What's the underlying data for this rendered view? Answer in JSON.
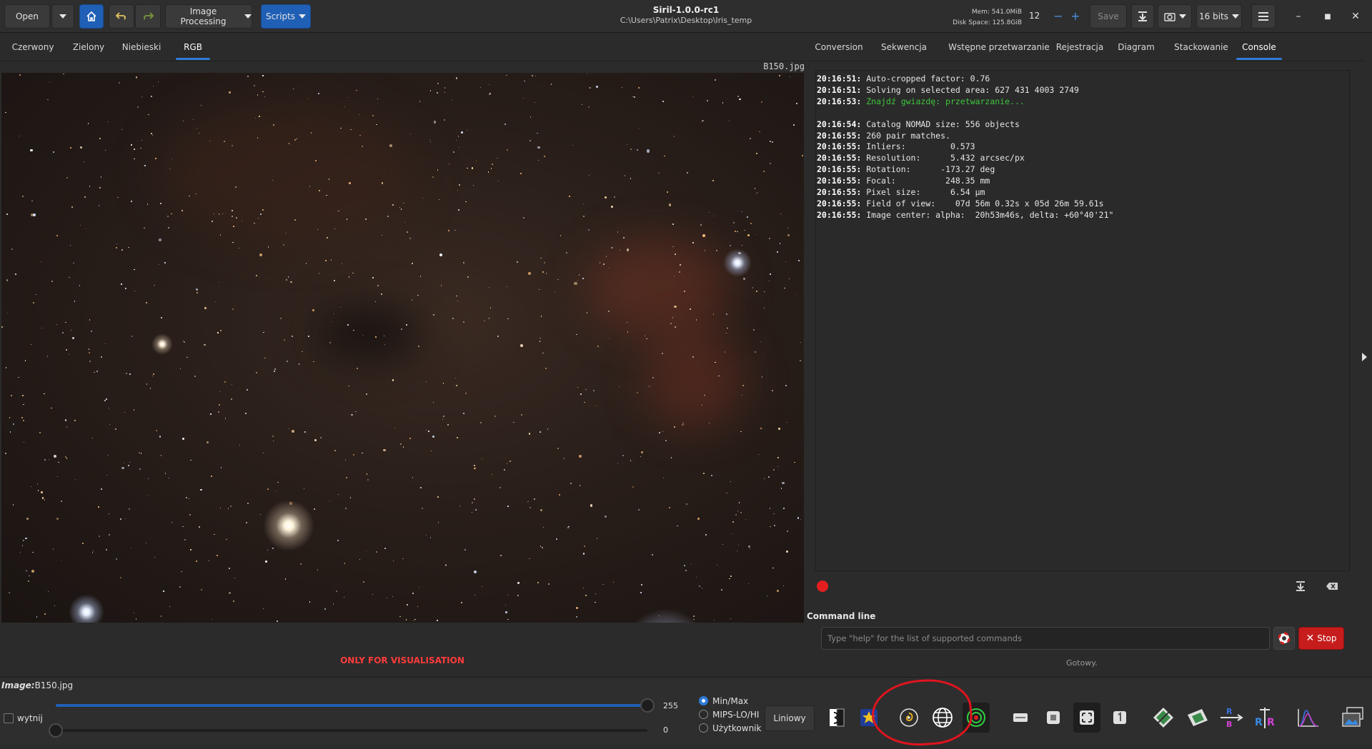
{
  "header": {
    "open_label": "Open",
    "image_processing_label": "Image Processing",
    "scripts_label": "Scripts",
    "app_title": "Siril-1.0.0-rc1",
    "working_dir": "C:\\Users\\Patrix\\Desktop\\Iris_temp",
    "mem_text": "Mem: 541.0MiB",
    "disk_text": "Disk Space: 125.8GiB",
    "thread_count": "12",
    "save_label": "Save",
    "bit_depth_label": "16 bits"
  },
  "view_tabs": [
    {
      "label": "Czerwony"
    },
    {
      "label": "Zielony"
    },
    {
      "label": "Niebieski"
    },
    {
      "label": "RGB"
    }
  ],
  "panel_tabs": [
    {
      "label": "Conversion"
    },
    {
      "label": "Sekwencja"
    },
    {
      "label": "Wstępne przetwarzanie"
    },
    {
      "label": "Rejestracja"
    },
    {
      "label": "Diagram"
    },
    {
      "label": "Stackowanie"
    },
    {
      "label": "Console"
    }
  ],
  "image": {
    "filename": "B150.jpg",
    "visualisation_note": "ONLY FOR VISUALISATION"
  },
  "console": {
    "lines": [
      {
        "time": "20:16:51:",
        "text": "Auto-cropped factor: 0.76"
      },
      {
        "time": "20:16:51:",
        "text": "Solving on selected area: 627 431 4003 2749"
      },
      {
        "time": "20:16:53:",
        "text": "Znajdź gwiazdę: przetwarzanie...",
        "green": true
      },
      {
        "blank": true
      },
      {
        "time": "20:16:54:",
        "text": "Catalog NOMAD size: 556 objects"
      },
      {
        "time": "20:16:55:",
        "text": "260 pair matches."
      },
      {
        "time": "20:16:55:",
        "text": "Inliers:         0.573"
      },
      {
        "time": "20:16:55:",
        "text": "Resolution:      5.432 arcsec/px"
      },
      {
        "time": "20:16:55:",
        "text": "Rotation:      -173.27 deg"
      },
      {
        "time": "20:16:55:",
        "text": "Focal:          248.35 mm"
      },
      {
        "time": "20:16:55:",
        "text": "Pixel size:      6.54 µm"
      },
      {
        "time": "20:16:55:",
        "text": "Field of view:    07d 56m 0.32s x 05d 26m 59.61s"
      },
      {
        "time": "20:16:55:",
        "text": "Image center: alpha:  20h53m46s, delta: +60°40'21\""
      }
    ]
  },
  "command_line": {
    "label": "Command line",
    "placeholder": "Type \"help\" for the list of supported commands",
    "stop_label": "Stop",
    "status": "Gotowy."
  },
  "bottom": {
    "image_label": "Image:",
    "image_name": "B150.jpg",
    "checkbox_label": "wytnij",
    "high_value": "255",
    "low_value": "0",
    "high_fraction": 1.0,
    "low_fraction": 0.0,
    "radio_options": [
      {
        "label": "Min/Max",
        "selected": true
      },
      {
        "label": "MIPS-LO/HI",
        "selected": false
      },
      {
        "label": "Użytkownik",
        "selected": false
      }
    ],
    "scale_mode": "Liniowy"
  },
  "colors": {
    "accent": "#2f7bd9",
    "stop_red": "#c71c1c",
    "console_green": "#3ec53e",
    "note_red": "#ff3b3b"
  },
  "icons": [
    "home-icon",
    "undo-icon",
    "redo-icon",
    "hamburger-menu-icon",
    "record-dot-icon",
    "clear-console-icon",
    "help-lifebuoy-icon"
  ]
}
